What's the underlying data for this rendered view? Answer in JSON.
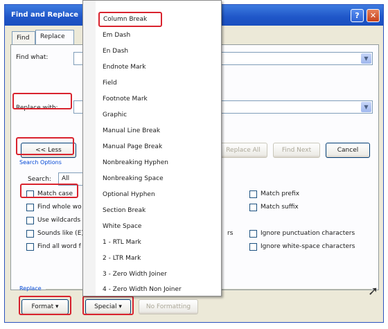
{
  "dialog": {
    "title": "Find and Replace",
    "help_glyph": "?",
    "close_glyph": "✕"
  },
  "tabs": [
    {
      "label": "Find"
    },
    {
      "label": "Replace"
    }
  ],
  "find": {
    "label": "Find what:",
    "value": ""
  },
  "replace": {
    "label": "Replace with:",
    "value": ""
  },
  "buttons": {
    "less": "<< Less",
    "replace_all": "Replace All",
    "find_next": "Find Next",
    "cancel": "Cancel",
    "format": "Format ▾",
    "special": "Special ▾",
    "no_formatting": "No Formatting"
  },
  "search_options": {
    "group_label": "Search Options",
    "search_label": "Search:",
    "search_value": "All"
  },
  "options_left": [
    {
      "label": "Match case"
    },
    {
      "label": "Find whole wo"
    },
    {
      "label": "Use wildcards"
    },
    {
      "label": "Sounds like (E)"
    },
    {
      "label": "Find all word f"
    }
  ],
  "options_right": [
    {
      "label": "Match prefix"
    },
    {
      "label": "Match suffix"
    },
    {
      "label": "Ignore punctuation characters"
    },
    {
      "label": "Ignore white-space characters"
    }
  ],
  "option_partial": "rs",
  "replace_group_label": "Replace",
  "special_menu": [
    "Column Break",
    "Em Dash",
    "En Dash",
    "Endnote Mark",
    "Field",
    "Footnote Mark",
    "Graphic",
    "Manual Line Break",
    "Manual Page Break",
    "Nonbreaking Hyphen",
    "Nonbreaking Space",
    "Optional Hyphen",
    "Section Break",
    "White Space",
    "1 - RTL Mark",
    "2 - LTR Mark",
    "3 - Zero Width Joiner",
    "4 - Zero Width Non Joiner"
  ],
  "colors": {
    "highlight": "#d9232e",
    "titlebar": "#1f56c8"
  }
}
